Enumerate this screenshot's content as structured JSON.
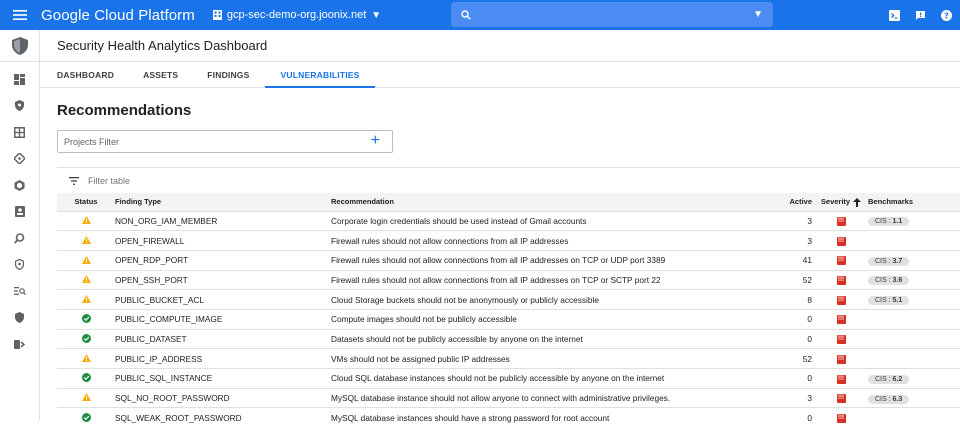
{
  "topbar": {
    "brand": "Google Cloud Platform",
    "org": "gcp-sec-demo-org.joonix.net",
    "search_placeholder": ""
  },
  "page": {
    "title": "Security Health Analytics Dashboard",
    "tabs": [
      {
        "label": "DASHBOARD",
        "active": false
      },
      {
        "label": "ASSETS",
        "active": false
      },
      {
        "label": "FINDINGS",
        "active": false
      },
      {
        "label": "VULNERABILITIES",
        "active": true
      }
    ]
  },
  "recommendations": {
    "title": "Recommendations",
    "projects_filter_placeholder": "Projects Filter",
    "filter_table_placeholder": "Filter table"
  },
  "table": {
    "columns": [
      "Status",
      "Finding Type",
      "Recommendation",
      "Active",
      "Severity",
      "Benchmarks"
    ],
    "sort_column": "Severity",
    "rows": [
      {
        "status": "warning",
        "type": "NON_ORG_IAM_MEMBER",
        "rec": "Corporate login credentials should be used instead of Gmail accounts",
        "active": "3",
        "bench_prefix": "CIS : ",
        "bench": "1.1"
      },
      {
        "status": "warning",
        "type": "OPEN_FIREWALL",
        "rec": "Firewall rules should not allow connections from all IP addresses",
        "active": "3",
        "bench_prefix": "",
        "bench": ""
      },
      {
        "status": "warning",
        "type": "OPEN_RDP_PORT",
        "rec": "Firewall rules should not allow connections from all IP addresses on TCP or UDP port 3389",
        "active": "41",
        "bench_prefix": "CIS : ",
        "bench": "3.7"
      },
      {
        "status": "warning",
        "type": "OPEN_SSH_PORT",
        "rec": "Firewall rules should not allow connections from all IP addresses on TCP or SCTP port 22",
        "active": "52",
        "bench_prefix": "CIS : ",
        "bench": "3.6"
      },
      {
        "status": "warning",
        "type": "PUBLIC_BUCKET_ACL",
        "rec": "Cloud Storage buckets should not be anonymously or publicly accessible",
        "active": "8",
        "bench_prefix": "CIS : ",
        "bench": "5.1"
      },
      {
        "status": "ok",
        "type": "PUBLIC_COMPUTE_IMAGE",
        "rec": "Compute images should not be publicly accessible",
        "active": "0",
        "bench_prefix": "",
        "bench": ""
      },
      {
        "status": "ok",
        "type": "PUBLIC_DATASET",
        "rec": "Datasets should not be publicly accessible by anyone on the internet",
        "active": "0",
        "bench_prefix": "",
        "bench": ""
      },
      {
        "status": "warning",
        "type": "PUBLIC_IP_ADDRESS",
        "rec": "VMs should not be assigned public IP addresses",
        "active": "52",
        "bench_prefix": "",
        "bench": ""
      },
      {
        "status": "ok",
        "type": "PUBLIC_SQL_INSTANCE",
        "rec": "Cloud SQL database instances should not be publicly accessible by anyone on the internet",
        "active": "0",
        "bench_prefix": "CIS : ",
        "bench": "6.2"
      },
      {
        "status": "warning",
        "type": "SQL_NO_ROOT_PASSWORD",
        "rec": "MySQL database instance should not allow anyone to connect with administrative privileges.",
        "active": "3",
        "bench_prefix": "CIS : ",
        "bench": "6.3"
      },
      {
        "status": "ok",
        "type": "SQL_WEAK_ROOT_PASSWORD",
        "rec": "MySQL database instances should have a strong password for root account",
        "active": "0",
        "bench_prefix": "",
        "bench": ""
      }
    ]
  },
  "colors": {
    "brand_blue": "#1a73e8",
    "warning": "#f9ab00",
    "ok": "#1e8e3e",
    "severity_high": "#d93025"
  }
}
